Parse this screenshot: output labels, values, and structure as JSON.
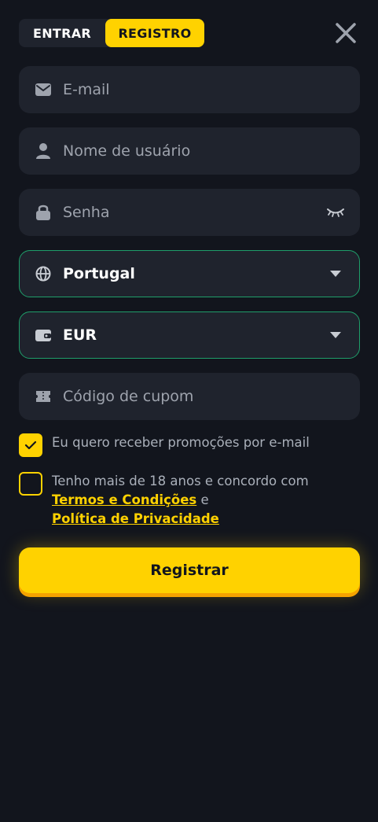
{
  "tabs": {
    "entrar": "ENTRAR",
    "registro": "REGISTRO"
  },
  "form": {
    "email_placeholder": "E-mail",
    "username_placeholder": "Nome de usuário",
    "password_placeholder": "Senha",
    "country_value": "Portugal",
    "currency_value": "EUR",
    "coupon_placeholder": "Código de cupom"
  },
  "promo_checkbox": {
    "checked": true,
    "label": "Eu quero receber promoções por e-mail"
  },
  "terms_checkbox": {
    "checked": false,
    "line1": "Tenho mais de 18 anos e concordo com",
    "terms_link": "Termos e Condições",
    "connector": "e",
    "privacy_link": "Política de Privacidade"
  },
  "submit_label": "Registrar",
  "icons": {
    "close": "close-icon",
    "email": "envelope-icon",
    "user": "user-icon",
    "lock": "lock-icon",
    "eye": "eye-closed-icon",
    "globe": "globe-icon",
    "wallet": "wallet-icon",
    "coupon": "ticket-icon",
    "chevron": "chevron-down-icon",
    "check": "check-icon"
  },
  "colors": {
    "background": "#12151d",
    "field": "#1f232d",
    "accent": "#ffd200",
    "select_border": "#1f9e6a"
  }
}
